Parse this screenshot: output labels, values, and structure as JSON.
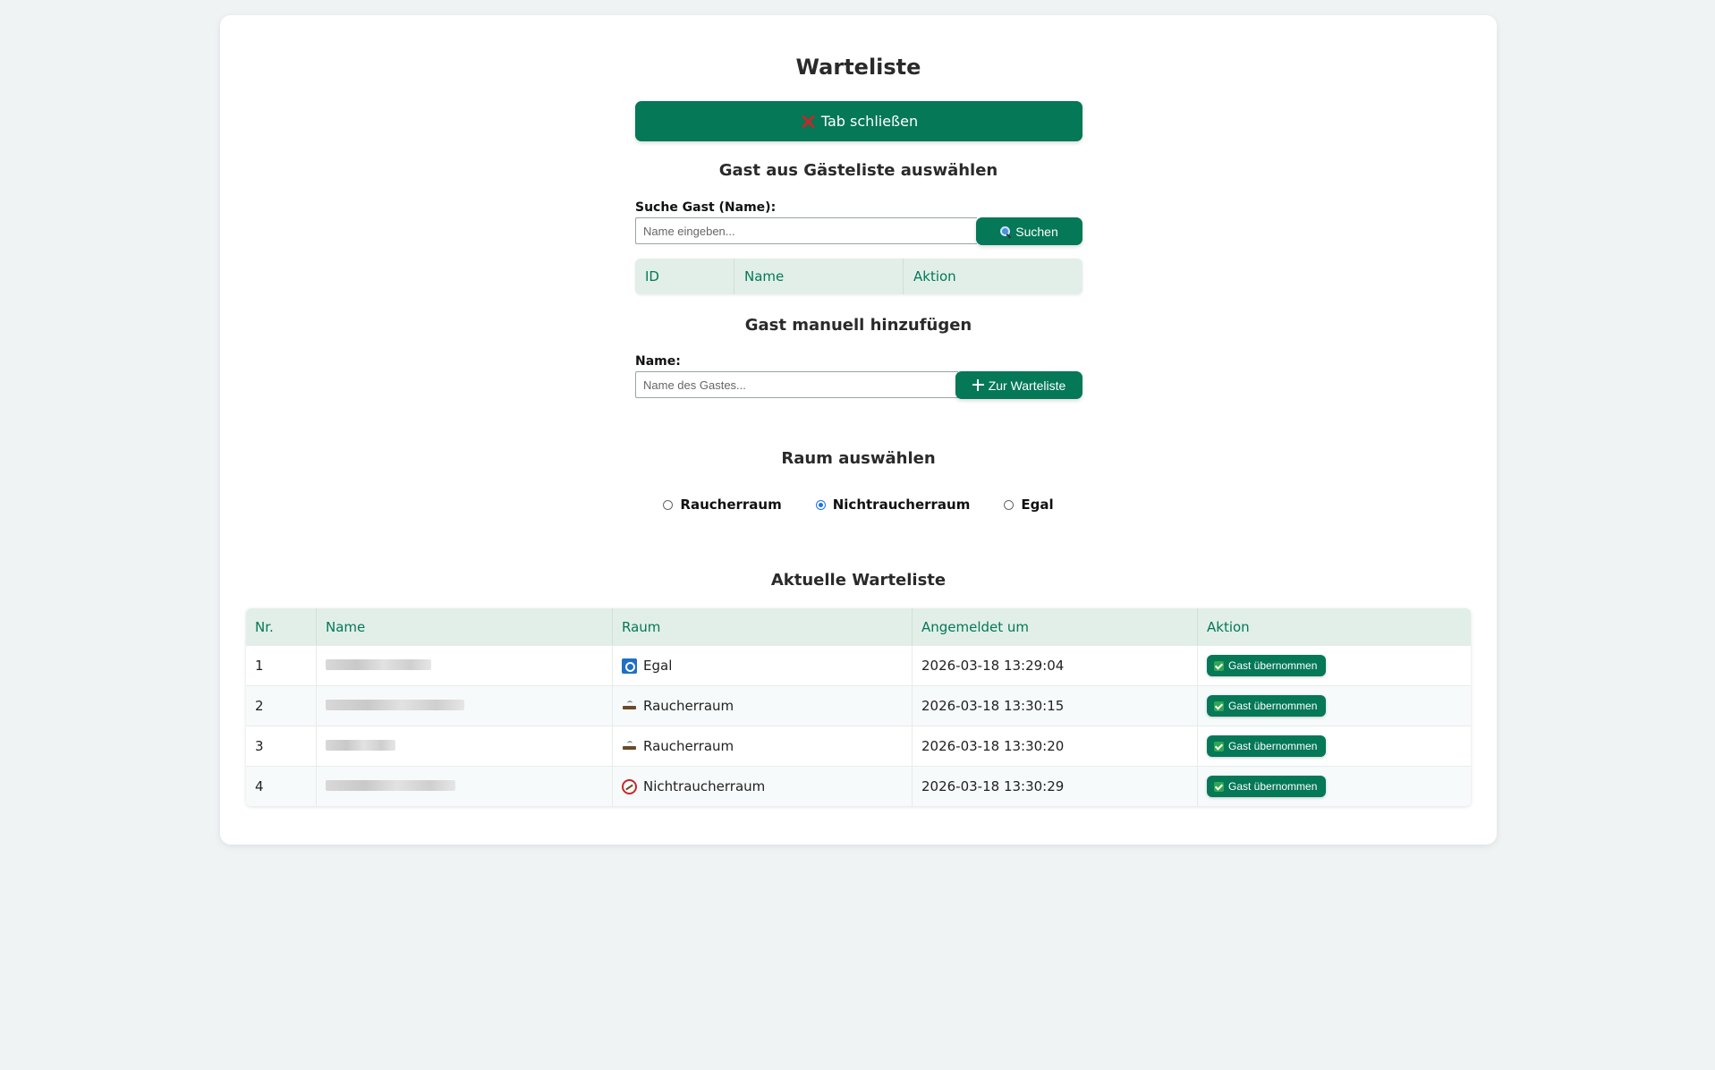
{
  "page": {
    "title": "Warteliste",
    "close_tab_label": "Tab schließen"
  },
  "guest_select": {
    "heading": "Gast aus Gästeliste auswählen",
    "search_label": "Suche Gast (Name):",
    "search_placeholder": "Name eingeben...",
    "search_button": "Suchen",
    "columns": [
      "ID",
      "Name",
      "Aktion"
    ]
  },
  "manual_add": {
    "heading": "Gast manuell hinzufügen",
    "name_label": "Name:",
    "name_placeholder": "Name des Gastes...",
    "add_button": "Zur Warteliste"
  },
  "room_select": {
    "heading": "Raum auswählen",
    "options": [
      "Raucherraum",
      "Nichtraucherraum",
      "Egal"
    ],
    "selected": "Nichtraucherraum"
  },
  "waitlist": {
    "heading": "Aktuelle Warteliste",
    "columns": [
      "Nr.",
      "Name",
      "Raum",
      "Angemeldet um",
      "Aktion"
    ],
    "rows": [
      {
        "nr": "1",
        "room": "Egal",
        "room_icon": "egal-icon",
        "time": "2026-03-18 13:29:04",
        "action": "Gast übernommen"
      },
      {
        "nr": "2",
        "room": "Raucherraum",
        "room_icon": "smoking-icon",
        "time": "2026-03-18 13:30:15",
        "action": "Gast übernommen"
      },
      {
        "nr": "3",
        "room": "Raucherraum",
        "room_icon": "smoking-icon",
        "time": "2026-03-18 13:30:20",
        "action": "Gast übernommen"
      },
      {
        "nr": "4",
        "room": "Nichtraucherraum",
        "room_icon": "no-smoking-icon",
        "time": "2026-03-18 13:30:29",
        "action": "Gast übernommen"
      }
    ]
  },
  "colors": {
    "accent": "#047857",
    "header_bg": "#e1efe8",
    "page_bg": "#eff3f4"
  }
}
